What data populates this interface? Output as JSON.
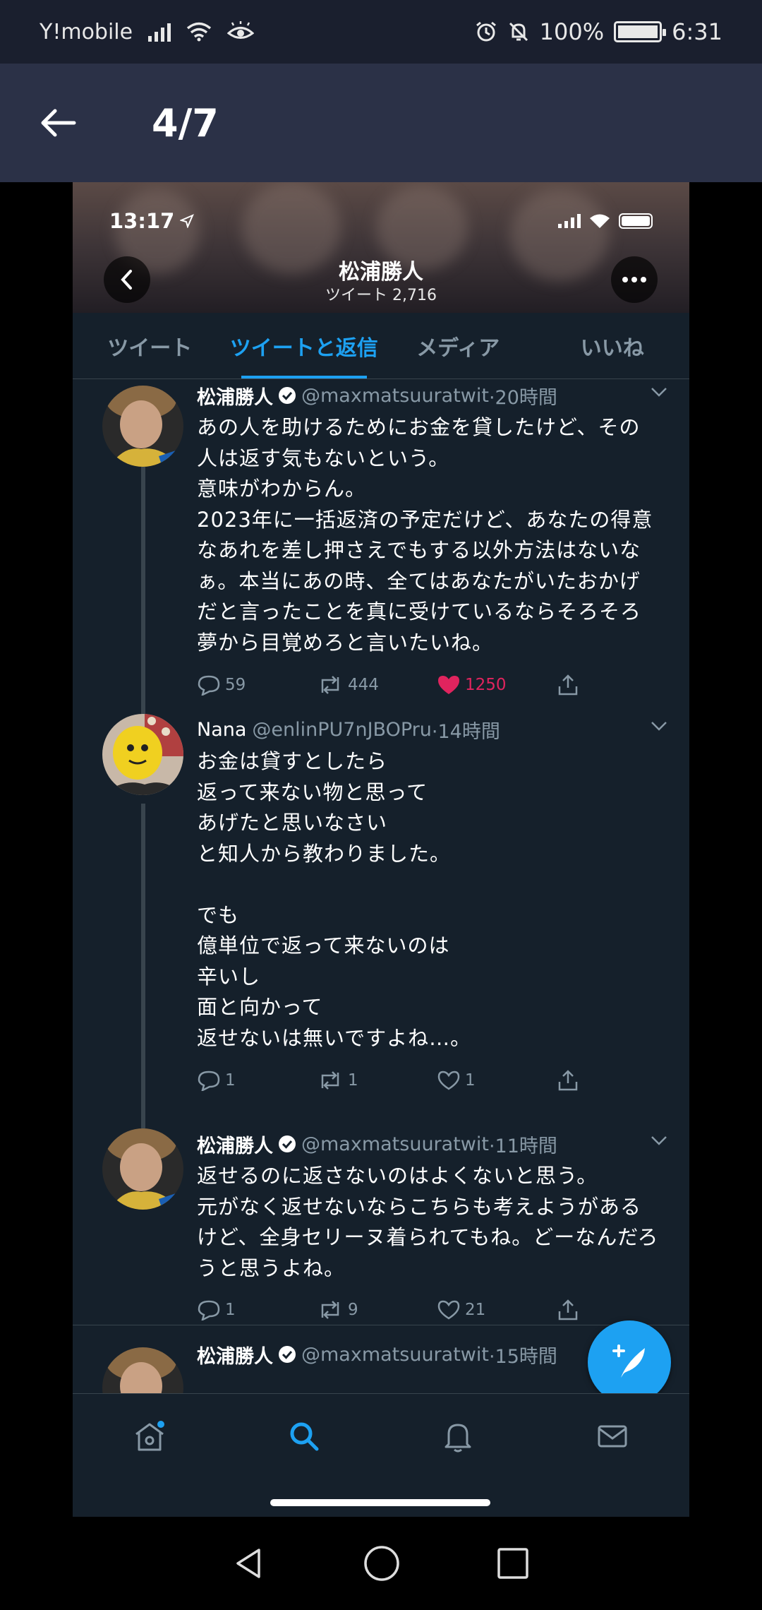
{
  "android_status": {
    "carrier": "Y!mobile",
    "battery": "100%",
    "time": "6:31",
    "icons": [
      "signal-icon",
      "wifi-icon",
      "eye-icon",
      "alarm-icon",
      "mute-icon",
      "battery-icon"
    ]
  },
  "viewer": {
    "page_indicator": "4/7"
  },
  "screenshot": {
    "ios_time": "13:17",
    "profile": {
      "name": "松浦勝人",
      "tweet_count": "ツイート 2,716"
    },
    "tabs": [
      {
        "label": "ツイート",
        "active": false
      },
      {
        "label": "ツイートと返信",
        "active": true
      },
      {
        "label": "メディア",
        "active": false
      },
      {
        "label": "いいね",
        "active": false
      }
    ],
    "tweets": [
      {
        "name": "松浦勝人",
        "verified": true,
        "handle": "@maxmatsuuratwit",
        "time": "·20時間",
        "text": "あの人を助けるためにお金を貸したけど、その人は返す気もないという。\n意味がわからん。\n2023年に一括返済の予定だけど、あなたの得意なあれを差し押さえでもする以外方法はないなぁ。本当にあの時、全てはあなたがいたおかげだと言ったことを真に受けているならそろそろ夢から目覚めろと言いたいね。",
        "replies": "59",
        "retweets": "444",
        "likes": "1250",
        "liked": true
      },
      {
        "name": "Nana",
        "verified": false,
        "handle": "@enlinPU7nJBOPru",
        "time": "·14時間",
        "text": "お金は貸すとしたら\n返って来ない物と思って\nあげたと思いなさい\nと知人から教わりました。\n\nでも\n億単位で返って来ないのは\n辛いし\n面と向かって\n返せないは無いですよね…。",
        "replies": "1",
        "retweets": "1",
        "likes": "1",
        "liked": false
      },
      {
        "name": "松浦勝人",
        "verified": true,
        "handle": "@maxmatsuuratwit",
        "time": "·11時間",
        "text": "返せるのに返さないのはよくないと思う。\n元がなく返せないならこちらも考えようがあるけど、全身セリーヌ着られてもね。どーなんだろうと思うよね。",
        "replies": "1",
        "retweets": "9",
        "likes": "21",
        "liked": false
      },
      {
        "name": "松浦勝人",
        "verified": true,
        "handle": "@maxmatsuuratwit",
        "time": "·15時間"
      }
    ],
    "bottom_nav": [
      "home-icon",
      "search-icon",
      "notifications-icon",
      "messages-icon"
    ]
  }
}
